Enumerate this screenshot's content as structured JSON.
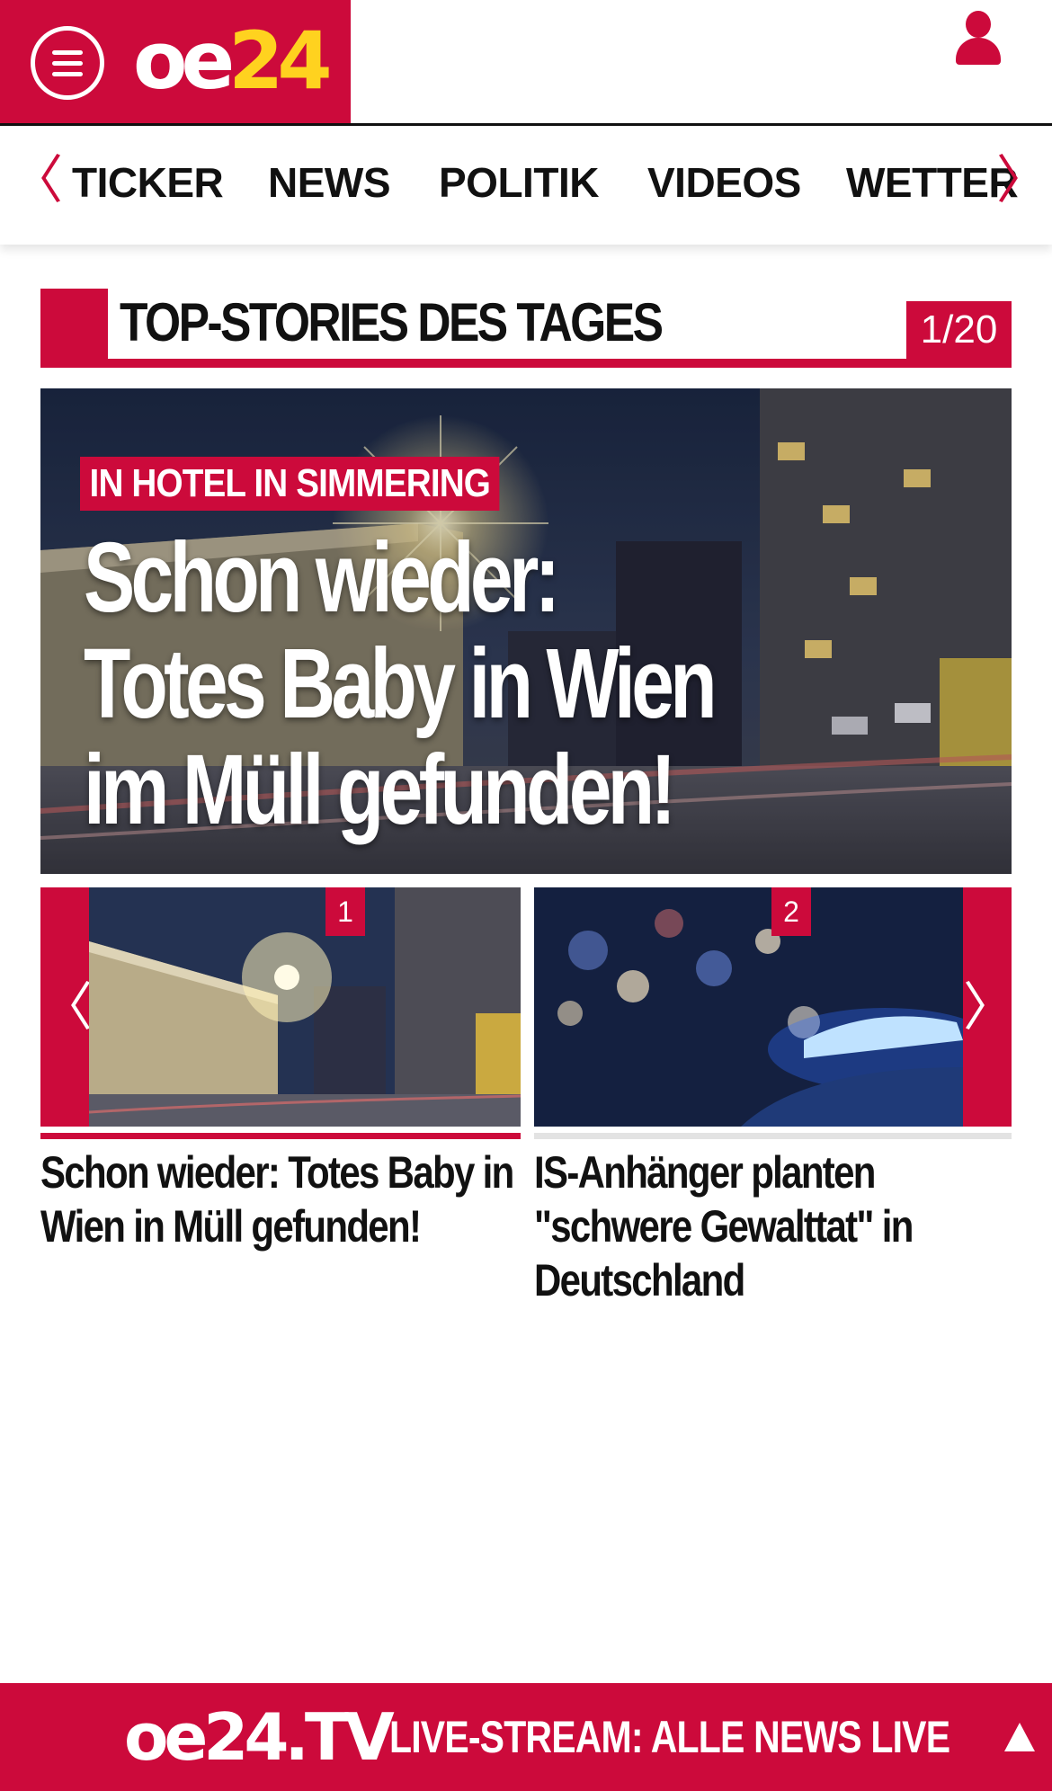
{
  "header": {
    "logo": {
      "part1": "oe",
      "part2": "24"
    },
    "menu_icon": "hamburger-menu-icon",
    "user_icon": "user-icon"
  },
  "nav": {
    "items": [
      {
        "label": "TICKER"
      },
      {
        "label": "NEWS"
      },
      {
        "label": "POLITIK"
      },
      {
        "label": "VIDEOS"
      },
      {
        "label": "WETTER"
      }
    ],
    "prev_glyph": "〈",
    "next_glyph": "〉"
  },
  "section": {
    "title": "TOP-STORIES DES TAGES",
    "counter": "1/20"
  },
  "hero": {
    "kicker": "IN HOTEL IN SIMMERING",
    "headline_lines": [
      "Schon wieder:",
      "Totes Baby in Wien",
      "im Müll gefunden!"
    ]
  },
  "carousel": {
    "prev_glyph": "〈",
    "next_glyph": "〉",
    "items": [
      {
        "badge": "1",
        "title": "Schon wieder: Totes Baby in Wien in Müll gefunden!"
      },
      {
        "badge": "2",
        "title": "IS-Anhänger planten \"schwere Gewalttat\" in Deutschland"
      }
    ]
  },
  "live_bar": {
    "logo": "oe24.TV",
    "text": "LIVE-STREAM:  ALLE NEWS LIVE"
  },
  "colors": {
    "brand_red": "#cc0a3b",
    "logo_yellow": "#ffd21f"
  }
}
